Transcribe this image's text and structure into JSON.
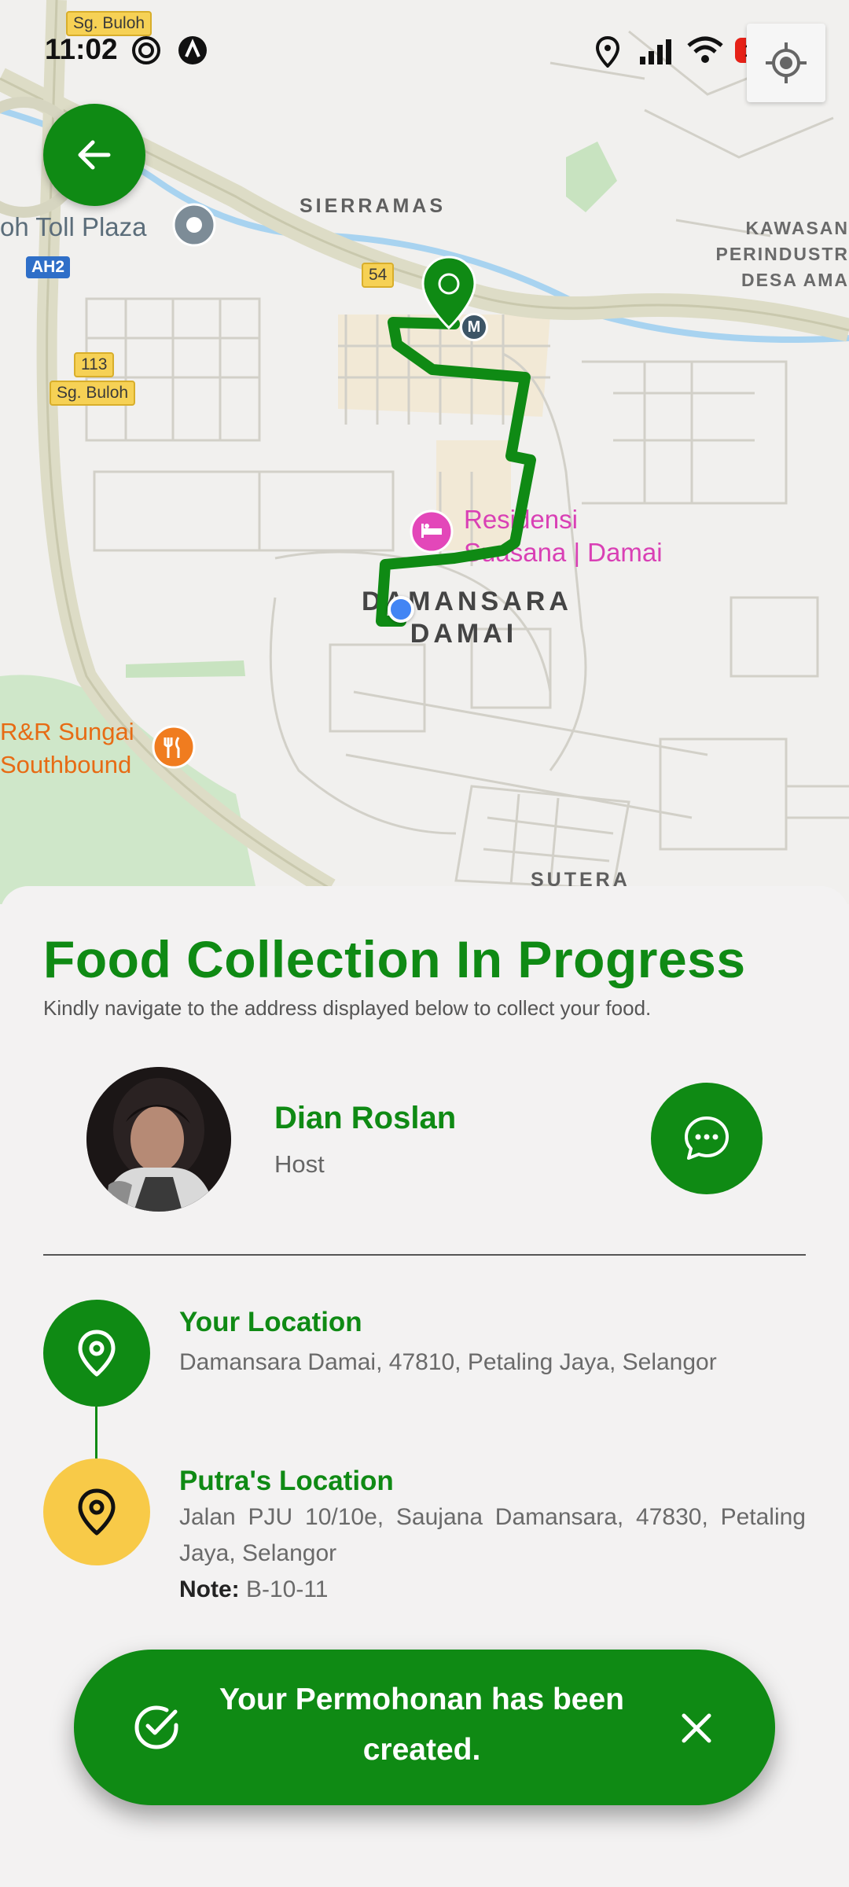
{
  "status_bar": {
    "time": "11:02",
    "battery": "17"
  },
  "map": {
    "labels": {
      "sierramas": "SIERRAMAS",
      "toll_plaza": "oh Toll Plaza",
      "kawasan": "KAWASAN",
      "perindustr": "PERINDUSTR",
      "desa_ama": "DESA AMA",
      "damansara": "DAMANSARA",
      "damai": "DAMAI",
      "sutera": "SUTERA",
      "residensi_line1": "Residensi",
      "residensi_line2": "Suasana | Damai",
      "rr_line1": "R&R Sungai",
      "rr_line2": "Southbound"
    },
    "shields": {
      "sg_buloh_top": "Sg. Buloh",
      "route_54": "54",
      "ah2": "AH2",
      "route_113": "113",
      "sg_buloh_mid": "Sg. Buloh"
    },
    "markers": {
      "mrt": "M"
    },
    "colors": {
      "route": "#0f8a14",
      "user_dot": "#4285f4",
      "poi_pink": "#d940b5",
      "poi_orange": "#e76b14"
    }
  },
  "sheet": {
    "title": "Food Collection In Progress",
    "subtitle": "Kindly navigate to the address displayed below to collect your food."
  },
  "host": {
    "name": "Dian Roslan",
    "role": "Host"
  },
  "your_location": {
    "title": "Your Location",
    "address": "Damansara Damai, 47810, Petaling Jaya, Selangor"
  },
  "putra_location": {
    "title": "Putra's Location",
    "address": "Jalan PJU 10/10e, Saujana Damansara, 47830, Petaling Jaya, Selangor",
    "note_label": "Note:",
    "note_value": " B-10-11"
  },
  "toast": {
    "message": "Your Permohonan has been created."
  },
  "colors": {
    "primary": "#0f8a14",
    "accent_yellow": "#f8ca48",
    "background": "#f3f2f2"
  },
  "icons": {
    "back": "arrow-left-icon",
    "locate": "my-location-icon",
    "chat": "chat-bubble-icon",
    "your_location": "location-pin-icon",
    "putra_location": "location-pin-icon",
    "toast_check": "check-circle-icon",
    "toast_close": "close-icon"
  }
}
